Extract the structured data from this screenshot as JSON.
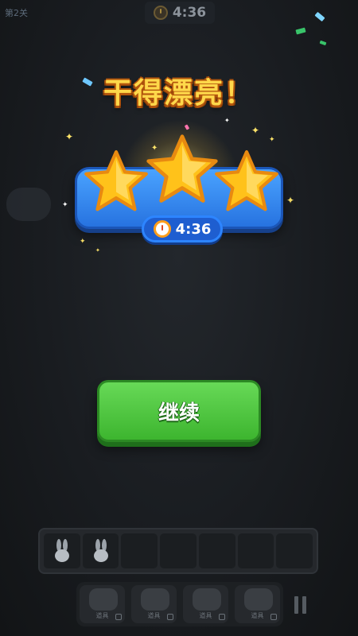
{
  "header": {
    "level_label": "第2关",
    "timer": "4:36"
  },
  "result": {
    "title": "干得漂亮！",
    "stars_earned": 3,
    "stars_total": 3,
    "time": "4:36",
    "continue_label": "继续"
  },
  "slots": {
    "total": 7,
    "filled": [
      {
        "icon": "bunny-icon"
      },
      {
        "icon": "bunny-icon"
      }
    ]
  },
  "tools": [
    {
      "icon": "tool-icon",
      "label": "道具",
      "locked": true
    },
    {
      "icon": "tool-icon",
      "label": "道具",
      "locked": true
    },
    {
      "icon": "tool-icon",
      "label": "道具",
      "locked": true
    },
    {
      "icon": "tool-icon",
      "label": "道具",
      "locked": true
    }
  ],
  "colors": {
    "title_fill": "#ffd84a",
    "panel_blue": "#2f86f0",
    "star_gold": "#ffc21a",
    "button_green": "#4cc63d",
    "background": "#171a1e"
  }
}
